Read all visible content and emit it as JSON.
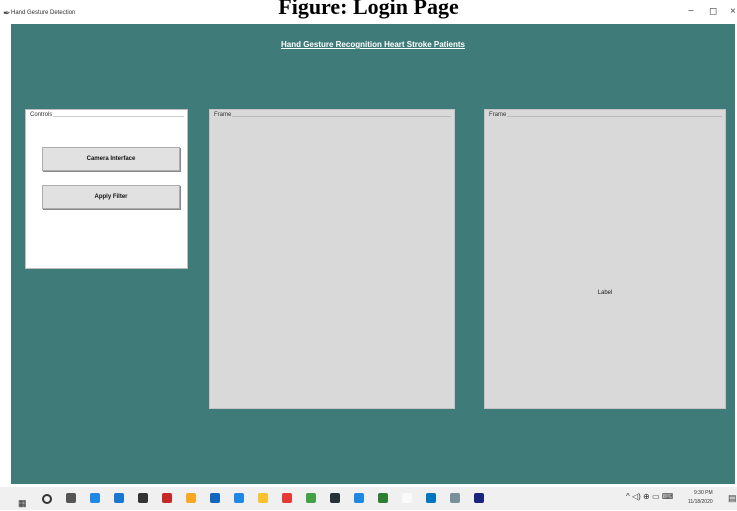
{
  "caption": "Figure: Login Page",
  "window": {
    "title": "Hand Gesture Detection",
    "minimize": "−",
    "maximize": "◻",
    "close": "×"
  },
  "app": {
    "heading": "Hand Gesture Recognition Heart Stroke Patients",
    "controls": {
      "group_label": "Controls",
      "camera_button": "Camera Interface",
      "filter_button": "Apply Filter"
    },
    "frame_left": {
      "group_label": "Frame"
    },
    "frame_right": {
      "group_label": "Frame",
      "label": "Label"
    }
  },
  "taskbar": {
    "icons": [
      "windows-icon",
      "search-icon",
      "task-view-icon",
      "edge-icon",
      "mail-icon",
      "store-icon",
      "app-icon",
      "explorer-icon",
      "app-icon-2",
      "vscode-icon",
      "chrome-icon",
      "firefox-icon",
      "app-icon-3",
      "terminal-icon",
      "app-icon-4",
      "app-icon-5",
      "app-icon-6",
      "app-icon-7",
      "app-icon-8",
      "app-icon-9"
    ],
    "time": "9:30 PM",
    "date": "11/18/2020"
  },
  "colors": {
    "background": "#3f7b78",
    "panel": "#d9d9d9",
    "button": "#e1e1e1"
  }
}
